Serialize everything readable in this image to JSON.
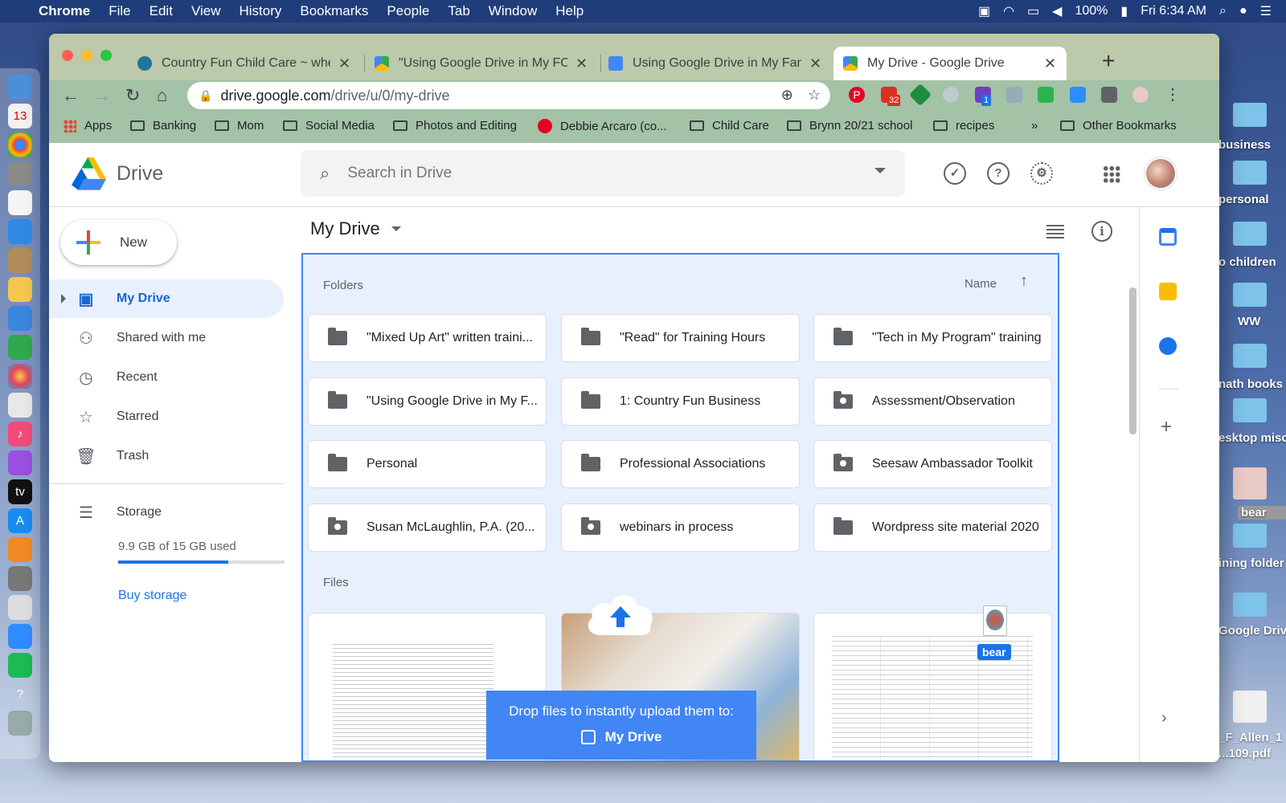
{
  "menubar": {
    "items": [
      "Chrome",
      "File",
      "Edit",
      "View",
      "History",
      "Bookmarks",
      "People",
      "Tab",
      "Window",
      "Help"
    ],
    "battery": "100%",
    "clock": "Fri 6:34 AM"
  },
  "desktop": {
    "items": [
      "business",
      "personal",
      "o children",
      "WW",
      "nath books",
      "esktop misc",
      "bear",
      "ining folder",
      "Google Drive",
      "_F_Allen_1",
      "...109.pdf"
    ]
  },
  "tabs": [
    {
      "title": "Country Fun Child Care ~ where",
      "favicon_color": "#21759b"
    },
    {
      "title": "\"Using Google Drive in My FCC",
      "favicon_color": "#34a853"
    },
    {
      "title": "Using Google Drive in My Family",
      "favicon_color": "#4285f4"
    },
    {
      "title": "My Drive - Google Drive",
      "favicon_color": "#fbbc04"
    }
  ],
  "omnibox": {
    "host": "drive.google.com",
    "path": "/drive/u/0/my-drive"
  },
  "extensions": {
    "gmail_badge": "32",
    "r_badge": "1"
  },
  "bookmarks": {
    "items": [
      "Apps",
      "Banking",
      "Mom",
      "Social Media",
      "Photos and Editing",
      "Debbie Arcaro (co...",
      "Child Care",
      "Brynn 20/21 school",
      "recipes"
    ],
    "overflow": "»",
    "other": "Other Bookmarks"
  },
  "drive": {
    "product_name": "Drive",
    "search": {
      "placeholder": "Search in Drive"
    },
    "new_label": "New",
    "nav": [
      {
        "label": "My Drive",
        "active": true
      },
      {
        "label": "Shared with me"
      },
      {
        "label": "Recent"
      },
      {
        "label": "Starred"
      },
      {
        "label": "Trash"
      }
    ],
    "storage": {
      "label": "Storage",
      "usage_text": "9.9 GB of 15 GB used",
      "used_fraction": 0.66,
      "buy_label": "Buy storage"
    },
    "main_title": "My Drive",
    "folders_heading": "Folders",
    "sort_label": "Name",
    "folders": [
      {
        "name": "\"Mixed Up Art\" written traini...",
        "shared": false
      },
      {
        "name": "\"Read\" for Training Hours",
        "shared": false
      },
      {
        "name": "\"Tech in My Program\" training",
        "shared": false
      },
      {
        "name": "\"Using Google Drive in My F...",
        "shared": false
      },
      {
        "name": "1: Country Fun Business",
        "shared": false
      },
      {
        "name": "Assessment/Observation",
        "shared": true
      },
      {
        "name": "Personal",
        "shared": false
      },
      {
        "name": "Professional Associations",
        "shared": false
      },
      {
        "name": "Seesaw Ambassador Toolkit",
        "shared": true
      },
      {
        "name": "Susan McLaughlin, P.A. (20...",
        "shared": true
      },
      {
        "name": "webinars in process",
        "shared": true
      },
      {
        "name": "Wordpress site material 2020",
        "shared": false
      }
    ],
    "files_heading": "Files",
    "drop_toast": {
      "line1": "Drop files to instantly upload them to:",
      "target": "My Drive"
    },
    "drag_label": "bear"
  },
  "colors": {
    "accent": "#1a73e8",
    "drop_bg": "#e8f0fe",
    "toast": "#4285f4"
  }
}
